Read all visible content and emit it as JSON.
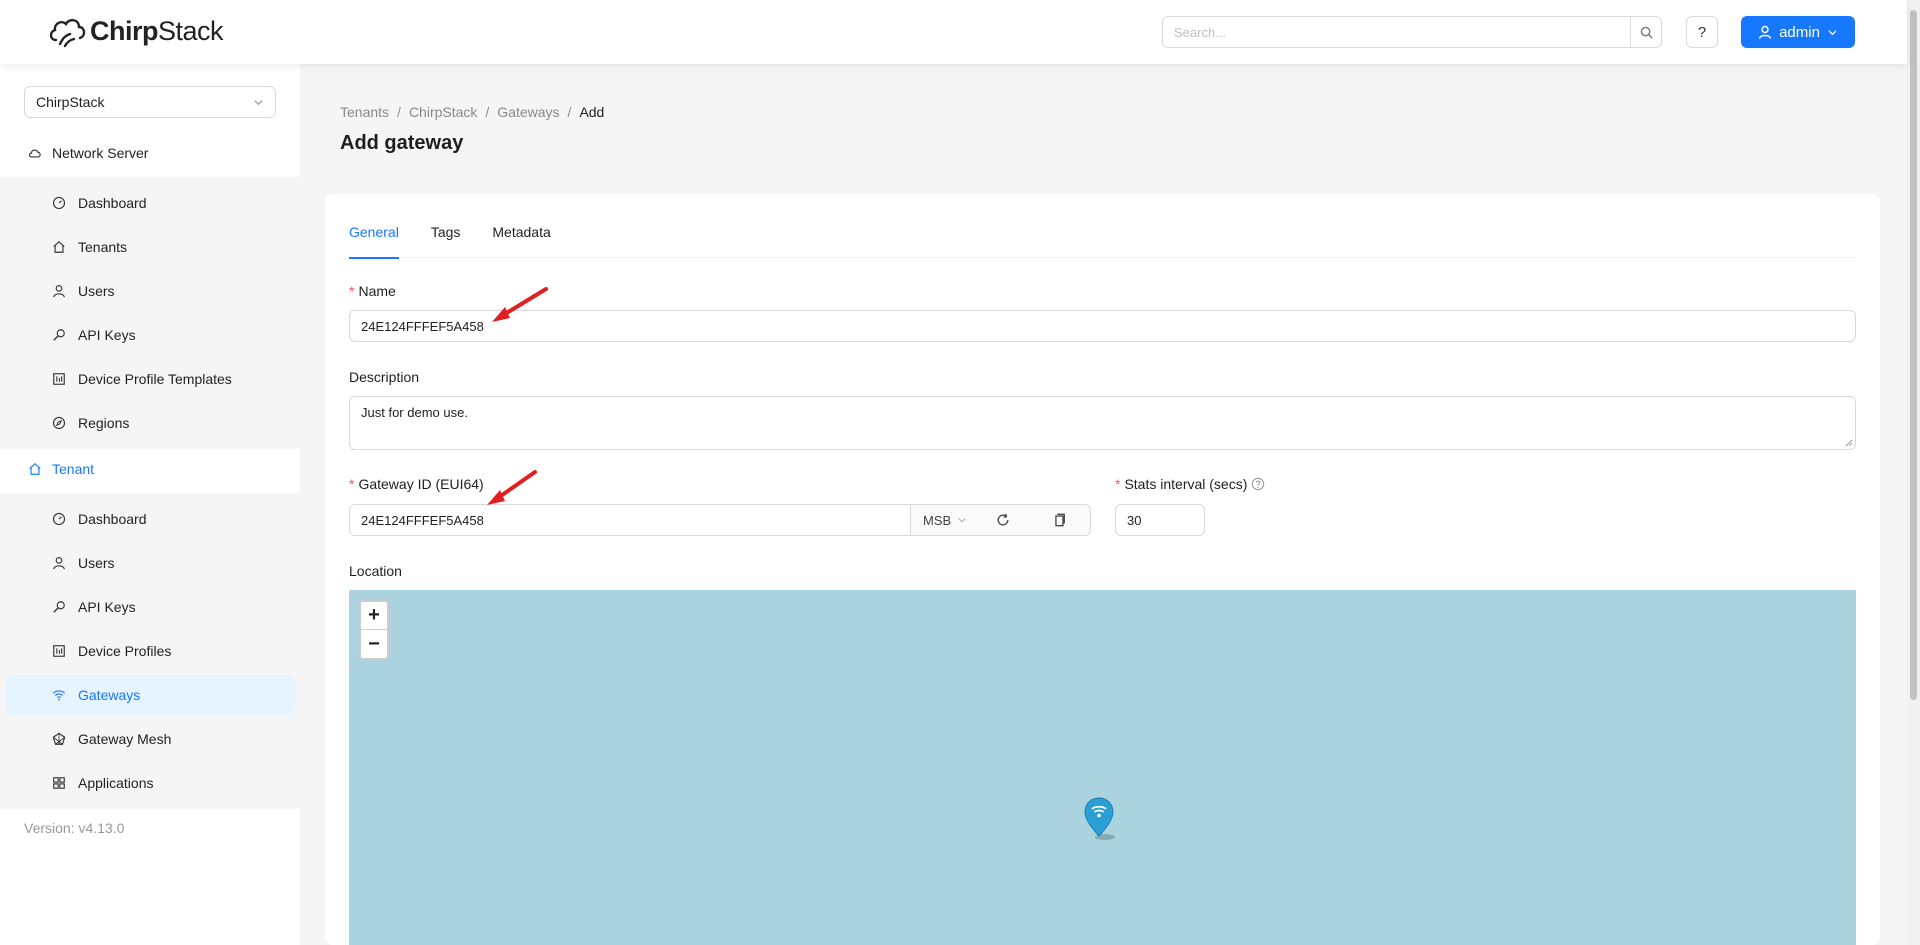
{
  "header": {
    "brand": {
      "part1": "Chirp",
      "part2": "Stack"
    },
    "search_placeholder": "Search...",
    "help_label": "?",
    "user_label": "admin"
  },
  "sidebar": {
    "tenant_select": "ChirpStack",
    "network_server": {
      "title": "Network Server",
      "items": [
        {
          "label": "Dashboard",
          "icon": "dashboard-icon"
        },
        {
          "label": "Tenants",
          "icon": "home-icon"
        },
        {
          "label": "Users",
          "icon": "user-icon"
        },
        {
          "label": "API Keys",
          "icon": "key-icon"
        },
        {
          "label": "Device Profile Templates",
          "icon": "profile-icon"
        },
        {
          "label": "Regions",
          "icon": "compass-icon"
        }
      ]
    },
    "tenant": {
      "title": "Tenant",
      "items": [
        {
          "label": "Dashboard",
          "icon": "dashboard-icon"
        },
        {
          "label": "Users",
          "icon": "user-icon"
        },
        {
          "label": "API Keys",
          "icon": "key-icon"
        },
        {
          "label": "Device Profiles",
          "icon": "profile-icon"
        },
        {
          "label": "Gateways",
          "icon": "wifi-icon",
          "selected": true
        },
        {
          "label": "Gateway Mesh",
          "icon": "mesh-icon"
        },
        {
          "label": "Applications",
          "icon": "apps-icon"
        }
      ]
    },
    "version": "Version: v4.13.0"
  },
  "breadcrumb": [
    "Tenants",
    "ChirpStack",
    "Gateways",
    "Add"
  ],
  "page_title": "Add gateway",
  "tabs": [
    "General",
    "Tags",
    "Metadata"
  ],
  "form": {
    "name_label": "Name",
    "name_value": "24E124FFFEF5A458",
    "description_label": "Description",
    "description_value": "Just for demo use.",
    "gateway_id_label": "Gateway ID (EUI64)",
    "gateway_id_value": "24E124FFFEF5A458",
    "byte_order": "MSB",
    "stats_label": "Stats interval (secs)",
    "stats_value": "30",
    "location_label": "Location"
  },
  "map": {
    "zoom_in": "+",
    "zoom_out": "−"
  },
  "colors": {
    "primary": "#1677ff",
    "required": "#ff4d4f",
    "map_water": "#aad3df",
    "annotation_arrow": "#e02020"
  }
}
